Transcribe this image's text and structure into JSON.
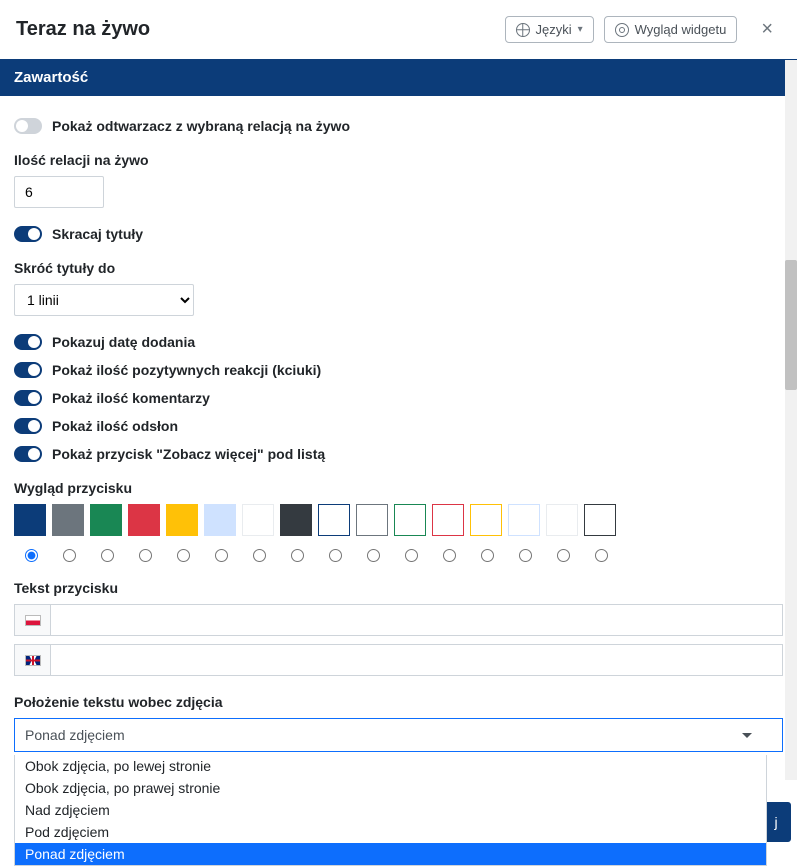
{
  "header": {
    "title": "Teraz na żywo",
    "languages_btn": "Języki",
    "appearance_btn": "Wygląd widgetu"
  },
  "section": {
    "title": "Zawartość"
  },
  "options": {
    "show_player": {
      "label": "Pokaż odtwarzacz z wybraną relacją na żywo",
      "on": false
    },
    "count_label": "Ilość relacji na żywo",
    "count_value": "6",
    "shorten_titles": {
      "label": "Skracaj tytuły",
      "on": true
    },
    "shorten_to_label": "Skróć tytuły do",
    "shorten_to_value": "1 linii",
    "show_date": {
      "label": "Pokazuj datę dodania",
      "on": true
    },
    "show_reactions": {
      "label": "Pokaż ilość pozytywnych reakcji (kciuki)",
      "on": true
    },
    "show_comments": {
      "label": "Pokaż ilość komentarzy",
      "on": true
    },
    "show_views": {
      "label": "Pokaż ilość odsłon",
      "on": true
    },
    "show_more_btn": {
      "label": "Pokaż przycisk \"Zobacz więcej\" pod listą",
      "on": true
    }
  },
  "button_appearance": {
    "label": "Wygląd przycisku",
    "colors": [
      {
        "bg": "#0c3c79",
        "border": "#0c3c79"
      },
      {
        "bg": "#6c757d",
        "border": "#6c757d"
      },
      {
        "bg": "#198754",
        "border": "#198754"
      },
      {
        "bg": "#dc3545",
        "border": "#dc3545"
      },
      {
        "bg": "#ffc107",
        "border": "#ffc107"
      },
      {
        "bg": "#cfe2ff",
        "border": "#cfe2ff"
      },
      {
        "bg": "#ffffff",
        "border": "#e9ecef"
      },
      {
        "bg": "#343a40",
        "border": "#343a40"
      },
      {
        "bg": "#ffffff",
        "border": "#0c3c79"
      },
      {
        "bg": "#ffffff",
        "border": "#6c757d"
      },
      {
        "bg": "#ffffff",
        "border": "#198754"
      },
      {
        "bg": "#ffffff",
        "border": "#dc3545"
      },
      {
        "bg": "#ffffff",
        "border": "#ffc107"
      },
      {
        "bg": "#ffffff",
        "border": "#cfe2ff"
      },
      {
        "bg": "#ffffff",
        "border": "#e9ecef"
      },
      {
        "bg": "#ffffff",
        "border": "#343a40"
      }
    ],
    "selected_index": 0
  },
  "button_text": {
    "label": "Tekst przycisku",
    "pl_value": "",
    "en_value": ""
  },
  "text_position": {
    "label": "Położenie tekstu wobec zdjęcia",
    "value": "Ponad zdjęciem",
    "options": [
      "Obok zdjęcia, po lewej stronie",
      "Obok zdjęcia, po prawej stronie",
      "Nad zdjęciem",
      "Pod zdjęciem",
      "Ponad zdjęciem"
    ],
    "selected_index": 4
  },
  "footer_btn_fragment": "j"
}
